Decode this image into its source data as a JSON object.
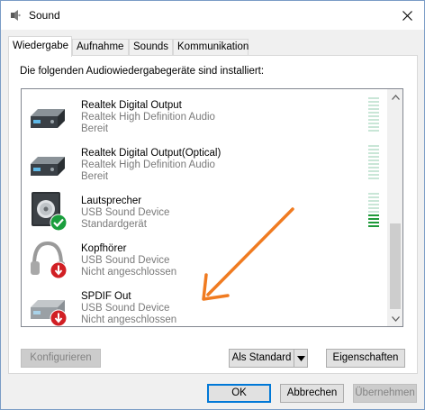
{
  "window": {
    "title": "Sound"
  },
  "tabs": [
    {
      "label": "Wiedergabe",
      "active": true
    },
    {
      "label": "Aufnahme",
      "active": false
    },
    {
      "label": "Sounds",
      "active": false
    },
    {
      "label": "Kommunikation",
      "active": false
    }
  ],
  "panel": {
    "intro": "Die folgenden Audiowiedergabegeräte sind installiert:"
  },
  "devices": [
    {
      "name": "Realtek Digital Output",
      "driver": "Realtek High Definition Audio",
      "status": "Bereit",
      "icon": "digital-output-icon",
      "badge": null,
      "meter_level": 0
    },
    {
      "name": "Realtek Digital Output(Optical)",
      "driver": "Realtek High Definition Audio",
      "status": "Bereit",
      "icon": "digital-output-icon",
      "badge": null,
      "meter_level": 0
    },
    {
      "name": "Lautsprecher",
      "driver": "USB Sound Device",
      "status": "Standardgerät",
      "icon": "speaker-icon",
      "badge": "default-check-badge",
      "meter_level": 0.4
    },
    {
      "name": "Kopfhörer",
      "driver": "USB Sound Device",
      "status": "Nicht angeschlossen",
      "icon": "headphones-icon",
      "badge": "not-connected-badge",
      "meter_level": null
    },
    {
      "name": "SPDIF Out",
      "driver": "USB Sound Device",
      "status": "Nicht angeschlossen",
      "icon": "digital-output-icon",
      "badge": "not-connected-badge",
      "meter_level": null
    }
  ],
  "buttons": {
    "configure": "Konfigurieren",
    "set_default": "Als Standard",
    "properties": "Eigenschaften",
    "ok": "OK",
    "cancel": "Abbrechen",
    "apply": "Übernehmen"
  },
  "colors": {
    "annotation_arrow": "#f07b21",
    "meter_on": "#1f9a3a",
    "meter_off": "#c9e6d7",
    "accent": "#0078d7"
  }
}
